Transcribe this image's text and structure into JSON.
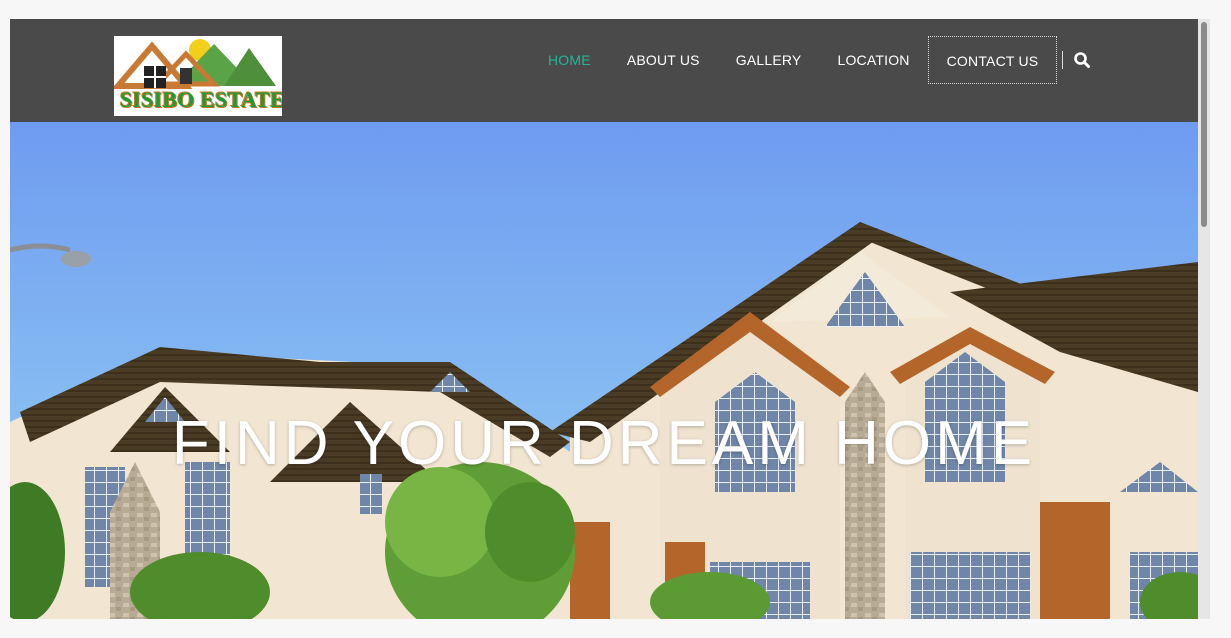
{
  "logo": {
    "text": "SISIBO ESTATE",
    "icon": "house-mountain-logo"
  },
  "nav": {
    "items": [
      {
        "label": "HOME",
        "active": true
      },
      {
        "label": "ABOUT US",
        "active": false
      },
      {
        "label": "GALLERY",
        "active": false
      },
      {
        "label": "LOCATION",
        "active": false
      },
      {
        "label": "CONTACT US",
        "active": false
      }
    ],
    "search_icon": "search-icon"
  },
  "hero": {
    "title": "FIND YOUR DREAM HOME"
  },
  "colors": {
    "header_bg": "#4a4a4a",
    "nav_active": "#22b59a",
    "nav_text": "#ffffff",
    "sky": "#6e9ff0"
  }
}
